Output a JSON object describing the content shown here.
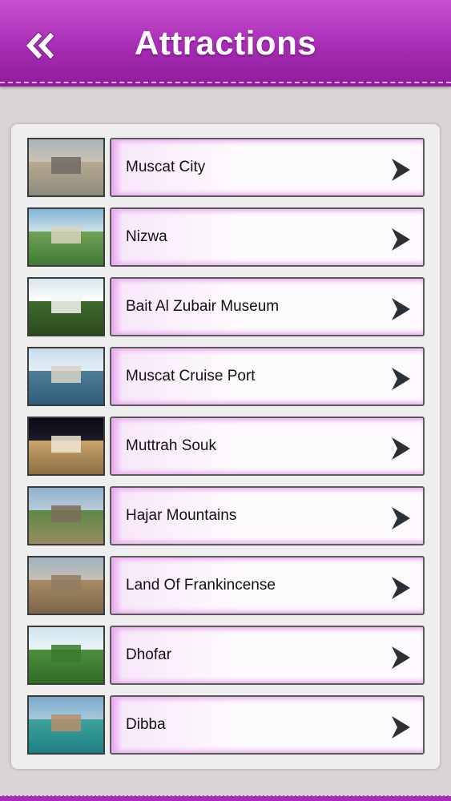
{
  "header": {
    "title": "Attractions",
    "back_icon": "double-chevron-left-icon"
  },
  "colors": {
    "accent": "#a62cb3",
    "accent_light": "#e7a2ee",
    "background": "#d9d5d6"
  },
  "attractions": [
    {
      "label": "Muscat City",
      "icon": "chevron-right-icon"
    },
    {
      "label": "Nizwa",
      "icon": "chevron-right-icon"
    },
    {
      "label": "Bait Al Zubair Museum",
      "icon": "chevron-right-icon"
    },
    {
      "label": "Muscat Cruise Port",
      "icon": "chevron-right-icon"
    },
    {
      "label": "Muttrah Souk",
      "icon": "chevron-right-icon"
    },
    {
      "label": "Hajar Mountains",
      "icon": "chevron-right-icon"
    },
    {
      "label": "Land Of Frankincense",
      "icon": "chevron-right-icon"
    },
    {
      "label": "Dhofar",
      "icon": "chevron-right-icon"
    },
    {
      "label": "Dibba",
      "icon": "chevron-right-icon"
    }
  ]
}
